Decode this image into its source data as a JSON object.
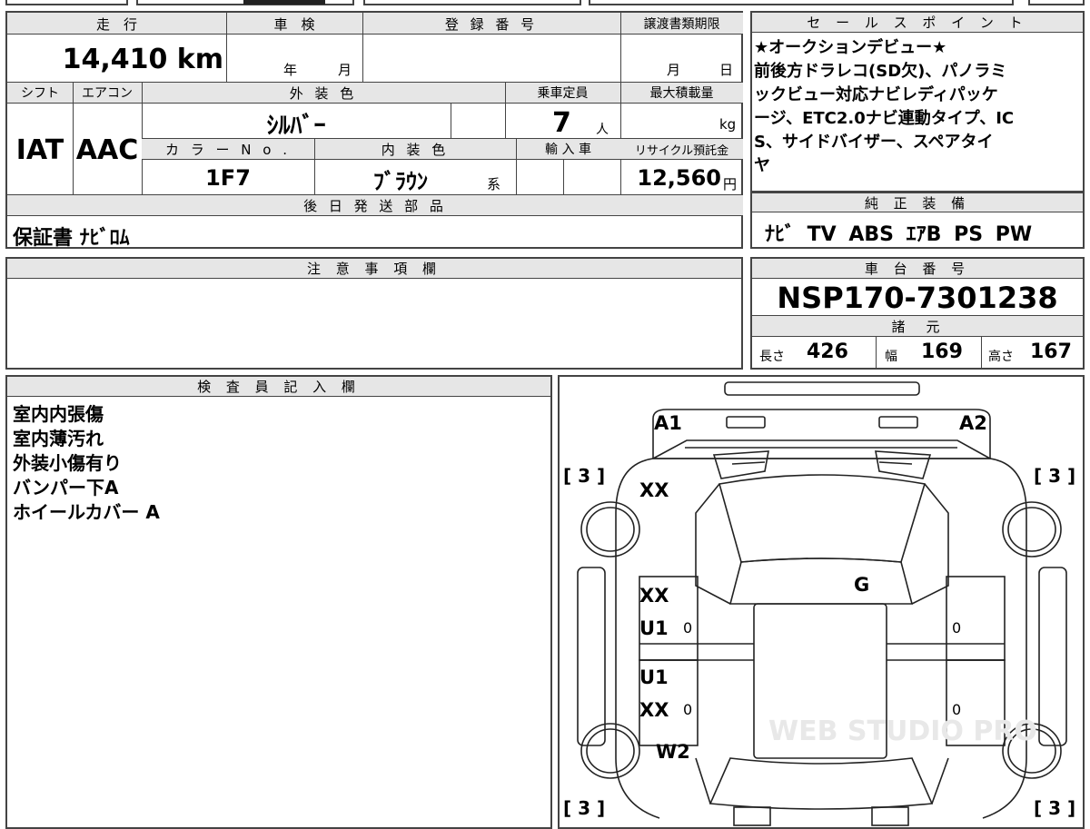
{
  "main_sheet": {
    "headers": {
      "mileage": "走　行",
      "inspection": "車　検",
      "registration": "登 録 番 号",
      "transfer_deadline": "譲渡書類期限",
      "shift": "シフト",
      "aircon": "エアコン",
      "exterior_color": "外 装 色",
      "capacity": "乗車定員",
      "max_load": "最大積載量",
      "color_no": "カ ラ ー N o .",
      "interior_color": "内 装 色",
      "import": "輸 入 車",
      "recycle": "リサイクル預託金",
      "parts": "後 日 発 送 部 品"
    },
    "values": {
      "mileage": "14,410 km",
      "inspection_year_unit": "年",
      "inspection_month_unit": "月",
      "transfer_month_unit": "月",
      "transfer_day_unit": "日",
      "shift": "IAT",
      "aircon": "AAC",
      "exterior_color": "ｼﾙﾊﾞｰ",
      "capacity": "7",
      "capacity_unit": "人",
      "max_load_unit": "kg",
      "color_no": "1F7",
      "interior_color": "ﾌﾞﾗｳﾝ",
      "interior_suffix": "系",
      "recycle": "12,560",
      "recycle_unit": "円",
      "parts": "保証書 ﾅﾋﾞﾛﾑ"
    }
  },
  "sales_point": {
    "header": "セ ー ル ス ポ イ ン ト",
    "lines": [
      "★オークションデビュー★",
      "前後方ドラレコ(SD欠)、パノラミ",
      "ックビュー対応ナビレディパッケ",
      "ージ、ETC2.0ナビ連動タイプ、IC",
      "S、サイドバイザー、スペアタイ",
      "ヤ"
    ]
  },
  "genuine_equipment": {
    "header": "純 正 装 備",
    "items": "ﾅﾋﾞ TV ABS ｴｱB PS PW"
  },
  "notes": {
    "header": "注 意 事 項 欄",
    "text": ""
  },
  "chassis": {
    "header": "車 台 番 号",
    "number": "NSP170-7301238",
    "spec_header": "諸　元",
    "length_label": "長さ",
    "length": "426",
    "width_label": "幅",
    "width": "169",
    "height_label": "高さ",
    "height": "167"
  },
  "inspector": {
    "header": "検 査 員 記 入 欄",
    "lines": [
      "室内内張傷",
      "室内薄汚れ",
      "外装小傷有り",
      "バンパー下A",
      "ホイールカバー A"
    ]
  },
  "diagram": {
    "marks": {
      "front_left": "A1",
      "front_right": "A2",
      "left_fender": "XX",
      "windshield": "G",
      "front_door_1": "XX",
      "front_door_2": "U1",
      "rear_door_1": "U1",
      "rear_door_2": "XX",
      "rear_quarter": "W2"
    },
    "tire_tl": "[ 3 ]",
    "tire_tr": "[ 3 ]",
    "tire_bl": "[ 3 ]",
    "tire_br": "[ 3 ]",
    "zero": "0",
    "watermark": "WEB STUDIO PRO"
  }
}
